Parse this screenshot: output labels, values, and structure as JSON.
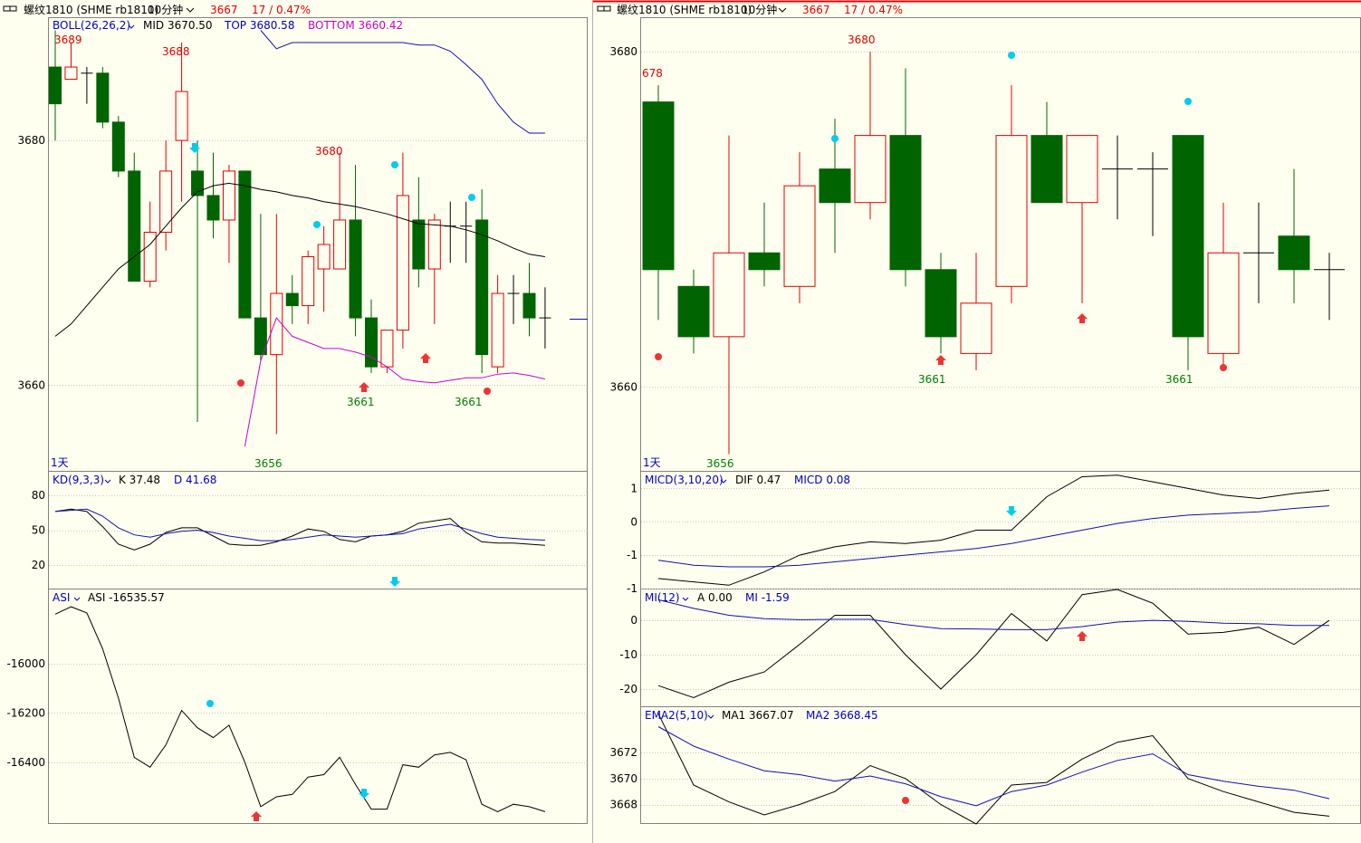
{
  "colors": {
    "background": "#fffff0",
    "up": "#e00000",
    "down": "#006400",
    "border": "#808080",
    "grid": "#c8c8c8",
    "label_red": "#e00000",
    "label_green": "#008000",
    "label_blue": "#0000c0",
    "label_magenta": "#cc00cc",
    "cyan": "#00ccee",
    "mark_red": "#ee3333",
    "line_black": "#000000",
    "line_blue": "#1010b0",
    "line_magenta": "#cc00cc"
  },
  "left": {
    "header": {
      "link_icon": "link-icon",
      "instrument": "螺纹1810 (SHME rb1810)",
      "period": "10分钟",
      "period_icon": "chevron-down-icon",
      "price": "3667",
      "change": "17 / 0.47%"
    },
    "main": {
      "indicator": "BOLL(26,26,2)",
      "mid_label": "MID 3670.50",
      "top_label": "TOP 3680.58",
      "bottom_label": "BOTTOM 3660.42",
      "period_tag": "1天",
      "y_ticks": [
        "3680",
        "3660"
      ],
      "price_labels": [
        {
          "text": "3689",
          "color": "red"
        },
        {
          "text": "3688",
          "color": "red"
        },
        {
          "text": "3680",
          "color": "red"
        },
        {
          "text": "3661",
          "color": "green"
        },
        {
          "text": "3661",
          "color": "green"
        },
        {
          "text": "3656",
          "color": "green"
        }
      ]
    },
    "kd": {
      "indicator": "KD(9,3,3)",
      "k_label": "K 37.48",
      "d_label": "D 41.68",
      "y_ticks": [
        "80",
        "50",
        "20"
      ]
    },
    "asi": {
      "indicator": "ASI",
      "asi_label": "ASI -16535.57",
      "y_ticks": [
        "-16000",
        "-16200",
        "-16400"
      ]
    }
  },
  "right": {
    "header": {
      "link_icon": "link-icon",
      "instrument": "螺纹1810 (SHME rb1810)",
      "period": "10分钟",
      "period_icon": "chevron-down-icon",
      "price": "3667",
      "change": "17 / 0.47%"
    },
    "main": {
      "period_tag": "1天",
      "y_ticks": [
        "3680",
        "3660"
      ],
      "price_labels": [
        {
          "text": "678",
          "color": "red"
        },
        {
          "text": "3680",
          "color": "red"
        },
        {
          "text": "3661",
          "color": "green"
        },
        {
          "text": "3661",
          "color": "green"
        },
        {
          "text": "3656",
          "color": "green"
        }
      ]
    },
    "micd": {
      "indicator": "MICD(3,10,20)",
      "dif_label": "DIF 0.47",
      "micd_label": "MICD 0.08",
      "y_ticks": [
        "1",
        "0",
        "-1",
        "-1"
      ]
    },
    "mi": {
      "indicator": "MI(12)",
      "a_label": "A 0.00",
      "mi_label": "MI -1.59",
      "y_ticks": [
        "0",
        "-10",
        "-20"
      ]
    },
    "ema2": {
      "indicator": "EMA2(5,10)",
      "ma1_label": "MA1 3667.07",
      "ma2_label": "MA2 3668.45",
      "y_ticks": [
        "3672",
        "3670",
        "3668"
      ]
    }
  },
  "chart_data": [
    {
      "type": "candlestick",
      "panel": "left-main",
      "ylim": [
        3653,
        3690
      ],
      "candles": [
        {
          "o": 3686,
          "h": 3689,
          "l": 3680,
          "c": 3683
        },
        {
          "o": 3685,
          "h": 3688,
          "l": 3685,
          "c": 3686
        },
        {
          "o": 3685.5,
          "h": 3686,
          "l": 3683,
          "c": 3685.5
        },
        {
          "o": 3685.5,
          "h": 3686,
          "l": 3681,
          "c": 3681.5
        },
        {
          "o": 3681.5,
          "h": 3682,
          "l": 3677,
          "c": 3677.5
        },
        {
          "o": 3677.5,
          "h": 3679,
          "l": 3669,
          "c": 3668.5
        },
        {
          "o": 3668.5,
          "h": 3675,
          "l": 3668,
          "c": 3672.5
        },
        {
          "o": 3672.5,
          "h": 3680,
          "l": 3671,
          "c": 3677.5
        },
        {
          "o": 3680,
          "h": 3688,
          "l": 3675,
          "c": 3684
        },
        {
          "o": 3677.5,
          "h": 3680,
          "l": 3657,
          "c": 3675.5
        },
        {
          "o": 3675.5,
          "h": 3679,
          "l": 3672,
          "c": 3673.5
        },
        {
          "o": 3673.5,
          "h": 3678,
          "l": 3670,
          "c": 3677.5
        },
        {
          "o": 3677.5,
          "h": 3677,
          "l": 3666,
          "c": 3665.5
        },
        {
          "o": 3665.5,
          "h": 3674,
          "l": 3662,
          "c": 3662.5
        },
        {
          "o": 3662.5,
          "h": 3674,
          "l": 3656,
          "c": 3667.5
        },
        {
          "o": 3667.5,
          "h": 3669,
          "l": 3665,
          "c": 3666.5
        },
        {
          "o": 3666.5,
          "h": 3671,
          "l": 3665,
          "c": 3670.5
        },
        {
          "o": 3669.5,
          "h": 3673,
          "l": 3666,
          "c": 3671.5
        },
        {
          "o": 3669.5,
          "h": 3679,
          "l": 3670,
          "c": 3673.5
        },
        {
          "o": 3673.5,
          "h": 3678,
          "l": 3664,
          "c": 3665.5
        },
        {
          "o": 3665.5,
          "h": 3667,
          "l": 3661,
          "c": 3661.5
        },
        {
          "o": 3661.5,
          "h": 3664,
          "l": 3661,
          "c": 3664.5
        },
        {
          "o": 3664.5,
          "h": 3679,
          "l": 3663,
          "c": 3675.5
        },
        {
          "o": 3673.5,
          "h": 3677,
          "l": 3668,
          "c": 3669.5
        },
        {
          "o": 3669.5,
          "h": 3674,
          "l": 3665,
          "c": 3673.5
        },
        {
          "o": 3673,
          "h": 3675,
          "l": 3670,
          "c": 3673
        },
        {
          "o": 3673,
          "h": 3675,
          "l": 3670,
          "c": 3673
        },
        {
          "o": 3673.5,
          "h": 3676,
          "l": 3661,
          "c": 3662.5
        },
        {
          "o": 3661.5,
          "h": 3669,
          "l": 3661,
          "c": 3667.5
        },
        {
          "o": 3667.5,
          "h": 3669,
          "l": 3665,
          "c": 3667.5
        },
        {
          "o": 3667.5,
          "h": 3670,
          "l": 3664,
          "c": 3665.5
        },
        {
          "o": 3665.5,
          "h": 3668,
          "l": 3663,
          "c": 3665.5
        }
      ],
      "series": [
        {
          "name": "MID",
          "values": [
            3664,
            3665,
            3666.5,
            3668,
            3669.5,
            3670.5,
            3671.5,
            3673,
            3674.5,
            3675.8,
            3676.3,
            3676.5,
            3676.3,
            3676,
            3675.8,
            3675.5,
            3675.3,
            3675,
            3674.8,
            3674.6,
            3674.3,
            3674,
            3673.6,
            3673.2,
            3673.1,
            3673,
            3672.7,
            3672.3,
            3671.8,
            3671.2,
            3670.7,
            3670.5
          ]
        },
        {
          "name": "TOP",
          "values": [
            null,
            null,
            null,
            null,
            null,
            null,
            null,
            null,
            null,
            null,
            null,
            null,
            null,
            3689,
            3687.5,
            3688,
            3688,
            3688,
            3688,
            3688,
            3688,
            3688,
            3688,
            3687.8,
            3687.8,
            3687.3,
            3686.2,
            3685,
            3683,
            3681.5,
            3680.6,
            3680.6
          ]
        },
        {
          "name": "BOTTOM",
          "values": [
            null,
            null,
            null,
            null,
            null,
            null,
            null,
            null,
            null,
            null,
            null,
            null,
            3655,
            3662,
            3665.5,
            3664,
            3663.5,
            3663,
            3663,
            3662.7,
            3662.3,
            3661.5,
            3660.5,
            3660.3,
            3660.2,
            3660.4,
            3660.6,
            3660.6,
            3660.9,
            3661,
            3660.8,
            3660.5
          ]
        }
      ]
    },
    {
      "type": "line",
      "panel": "left-kd",
      "ylim": [
        0,
        100
      ],
      "series": [
        {
          "name": "K",
          "values": [
            66,
            68,
            66,
            53,
            38,
            33,
            38,
            48,
            52,
            52,
            45,
            38,
            37,
            37,
            40,
            45,
            51,
            49,
            42,
            40,
            45,
            46,
            49,
            56,
            58,
            60,
            48,
            40,
            39,
            39,
            38,
            37
          ]
        },
        {
          "name": "D",
          "values": [
            66,
            67,
            68,
            62,
            52,
            46,
            44,
            47,
            49,
            50,
            48,
            45,
            43,
            41,
            41,
            42,
            44,
            46,
            45,
            44,
            45,
            46,
            47,
            51,
            53,
            55,
            51,
            47,
            44,
            43,
            42,
            41.5
          ]
        }
      ]
    },
    {
      "type": "line",
      "panel": "left-asi",
      "ylim": [
        -16650,
        -15700
      ],
      "series": [
        {
          "name": "ASI",
          "values": [
            -15800,
            -15770,
            -15795,
            -15940,
            -16140,
            -16380,
            -16420,
            -16330,
            -16190,
            -16260,
            -16300,
            -16250,
            -16400,
            -16580,
            -16540,
            -16530,
            -16460,
            -16450,
            -16380,
            -16490,
            -16590,
            -16590,
            -16410,
            -16420,
            -16370,
            -16360,
            -16390,
            -16570,
            -16600,
            -16570,
            -16580,
            -16600
          ]
        }
      ]
    },
    {
      "type": "candlestick",
      "panel": "right-main",
      "ylim": [
        3655,
        3682
      ],
      "candles": [
        {
          "o": 3677,
          "h": 3678,
          "l": 3664,
          "c": 3667
        },
        {
          "o": 3666,
          "h": 3667,
          "l": 3662,
          "c": 3663
        },
        {
          "o": 3663,
          "h": 3675,
          "l": 3656,
          "c": 3668
        },
        {
          "o": 3668,
          "h": 3671,
          "l": 3666,
          "c": 3667
        },
        {
          "o": 3666,
          "h": 3674,
          "l": 3665,
          "c": 3672
        },
        {
          "o": 3673,
          "h": 3676,
          "l": 3668,
          "c": 3671
        },
        {
          "o": 3671,
          "h": 3680,
          "l": 3670,
          "c": 3675
        },
        {
          "o": 3675,
          "h": 3679,
          "l": 3666,
          "c": 3667
        },
        {
          "o": 3667,
          "h": 3668,
          "l": 3662,
          "c": 3663
        },
        {
          "o": 3662,
          "h": 3668,
          "l": 3661,
          "c": 3665
        },
        {
          "o": 3666,
          "h": 3678,
          "l": 3665,
          "c": 3675
        },
        {
          "o": 3675,
          "h": 3677,
          "l": 3671,
          "c": 3671
        },
        {
          "o": 3671,
          "h": 3675,
          "l": 3665,
          "c": 3675
        },
        {
          "o": 3673,
          "h": 3675,
          "l": 3670,
          "c": 3673
        },
        {
          "o": 3673,
          "h": 3674,
          "l": 3669,
          "c": 3673
        },
        {
          "o": 3675,
          "h": 3675,
          "l": 3661,
          "c": 3663
        },
        {
          "o": 3662,
          "h": 3671,
          "l": 3661,
          "c": 3668
        },
        {
          "o": 3668,
          "h": 3671,
          "l": 3665,
          "c": 3668
        },
        {
          "o": 3669,
          "h": 3673,
          "l": 3665,
          "c": 3667
        },
        {
          "o": 3667,
          "h": 3668,
          "l": 3664,
          "c": 3667
        }
      ]
    },
    {
      "type": "line",
      "panel": "right-micd",
      "ylim": [
        -2,
        1.5
      ],
      "series": [
        {
          "name": "DIF",
          "values": [
            -1.7,
            -1.8,
            -1.9,
            -1.5,
            -1.0,
            -0.75,
            -0.6,
            -0.65,
            -0.55,
            -0.25,
            -0.25,
            0.75,
            1.35,
            1.4,
            1.2,
            1.0,
            0.8,
            0.7,
            0.85,
            0.95
          ]
        },
        {
          "name": "MICD",
          "values": [
            -1.15,
            -1.3,
            -1.35,
            -1.35,
            -1.3,
            -1.2,
            -1.1,
            -1.0,
            -0.9,
            -0.8,
            -0.65,
            -0.45,
            -0.25,
            -0.05,
            0.1,
            0.2,
            0.25,
            0.3,
            0.4,
            0.48
          ]
        }
      ]
    },
    {
      "type": "line",
      "panel": "right-mi",
      "ylim": [
        -25,
        9
      ],
      "series": [
        {
          "name": "A",
          "values": [
            -19,
            -22.5,
            -18,
            -15,
            -7,
            1.5,
            1.5,
            -10,
            -20,
            -10,
            2,
            -6,
            7.5,
            9,
            5,
            -4,
            -3.5,
            -2,
            -7,
            0
          ]
        },
        {
          "name": "MI",
          "values": [
            6,
            3.5,
            1.5,
            0.5,
            0.2,
            0.3,
            0.3,
            -1.2,
            -2.4,
            -2.5,
            -2.7,
            -2.7,
            -1.8,
            -0.5,
            0,
            -0.3,
            -0.8,
            -1,
            -1.5,
            -1.5
          ]
        }
      ]
    },
    {
      "type": "line",
      "panel": "right-ema2",
      "ylim": [
        3666.5,
        3675.5
      ],
      "series": [
        {
          "name": "MA1",
          "values": [
            3675,
            3669.5,
            3668.2,
            3667.2,
            3668,
            3669,
            3671,
            3670,
            3668,
            3666.5,
            3669.5,
            3669.7,
            3671.5,
            3672.8,
            3673.3,
            3670,
            3669,
            3668.2,
            3667.4,
            3667.1
          ]
        },
        {
          "name": "MA2",
          "values": [
            3674,
            3672.5,
            3671.5,
            3670.6,
            3670.3,
            3669.8,
            3670.2,
            3669.6,
            3668.6,
            3667.9,
            3669,
            3669.5,
            3670.5,
            3671.4,
            3671.9,
            3670.3,
            3669.8,
            3669.4,
            3669.1,
            3668.45
          ]
        }
      ]
    }
  ]
}
